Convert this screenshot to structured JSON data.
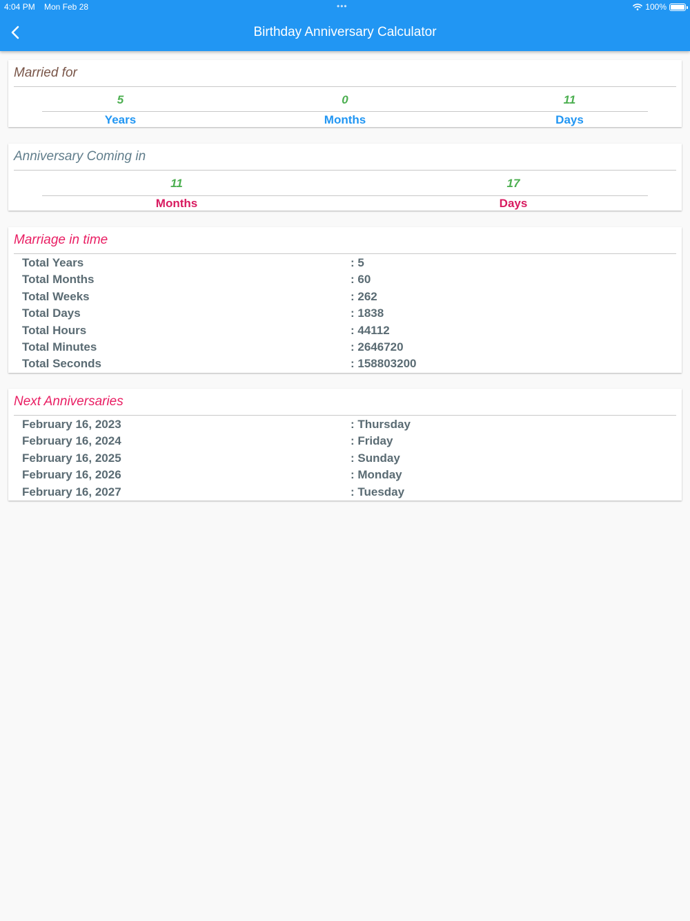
{
  "status_bar": {
    "time": "4:04 PM",
    "date": "Mon Feb 28",
    "battery": "100%"
  },
  "colors": {
    "app_bar": "#2196f3",
    "green_value": "#4caf50",
    "blue_label": "#2196f3",
    "pink_label": "#d81b60",
    "pink_title": "#e91e63",
    "brown_title": "#795548",
    "gray_title": "#607d8b"
  },
  "header": {
    "title": "Birthday Anniversary Calculator",
    "back_icon": "chevron-left-icon"
  },
  "married_for": {
    "title": "Married for",
    "items": [
      {
        "value": "5",
        "label": "Years"
      },
      {
        "value": "0",
        "label": "Months"
      },
      {
        "value": "11",
        "label": "Days"
      }
    ]
  },
  "anniversary_coming": {
    "title": "Anniversary Coming in",
    "items": [
      {
        "value": "11",
        "label": "Months"
      },
      {
        "value": "17",
        "label": "Days"
      }
    ]
  },
  "marriage_in_time": {
    "title": "Marriage in time",
    "rows": [
      {
        "label": "Total Years",
        "value": ": 5"
      },
      {
        "label": "Total Months",
        "value": ": 60"
      },
      {
        "label": "Total Weeks",
        "value": ": 262"
      },
      {
        "label": "Total Days",
        "value": ": 1838"
      },
      {
        "label": "Total Hours",
        "value": ": 44112"
      },
      {
        "label": "Total Minutes",
        "value": ": 2646720"
      },
      {
        "label": "Total Seconds",
        "value": ": 158803200"
      }
    ]
  },
  "next_anniversaries": {
    "title": "Next Anniversaries",
    "rows": [
      {
        "date": "February 16, 2023",
        "day": ": Thursday"
      },
      {
        "date": "February 16, 2024",
        "day": ": Friday"
      },
      {
        "date": "February 16, 2025",
        "day": ": Sunday"
      },
      {
        "date": "February 16, 2026",
        "day": ": Monday"
      },
      {
        "date": "February 16, 2027",
        "day": ": Tuesday"
      }
    ]
  }
}
